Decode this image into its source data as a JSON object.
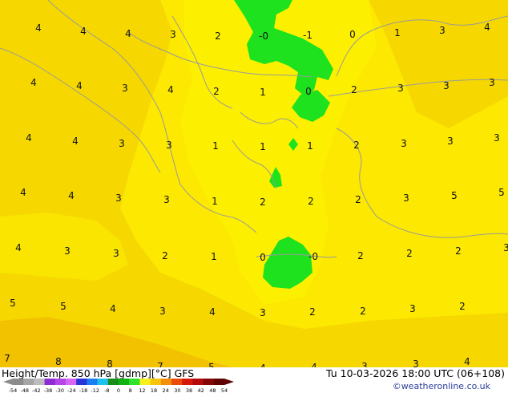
{
  "map": {
    "labels_grid": [
      [
        "4",
        "4",
        "4",
        "3",
        "2",
        "-0",
        "-1",
        "0",
        "1",
        "3",
        "4"
      ],
      [
        "4",
        "4",
        "3",
        "4",
        "2",
        "1",
        "0",
        "2",
        "3",
        "3",
        "3"
      ],
      [
        "4",
        "4",
        "3",
        "3",
        "1",
        "1",
        "1",
        "2",
        "3",
        "3",
        "3"
      ],
      [
        "4",
        "4",
        "3",
        "3",
        "1",
        "2",
        "2",
        "2",
        "3",
        "5",
        "5"
      ],
      [
        "4",
        "3",
        "3",
        "2",
        "1",
        "0",
        "-0",
        "2",
        "2",
        "2",
        "3"
      ],
      [
        "5",
        "5",
        "4",
        "3",
        "4",
        "3",
        "2",
        "2",
        "3",
        "2"
      ],
      [
        "7",
        "8",
        "8",
        "7",
        "5",
        "4",
        "4",
        "3",
        "3",
        "4"
      ]
    ],
    "colors": {
      "zone_yellow_dark": "#f6d800",
      "zone_yellow_light": "#fcf000",
      "zone_yellow_mid": "#f9e500",
      "zone_orange": "#f2c200",
      "zone_green": "#1ee21e",
      "coastline": "#9a9a9a"
    }
  },
  "footer": {
    "left_title": "Height/Temp. 850 hPa [gdmp][°C] GFS",
    "datetime": "Tu 10-03-2026 18:00 UTC (06+108)",
    "copyright": "©weatheronline.co.uk",
    "scale_ticks": [
      "-54",
      "-48",
      "-42",
      "-38",
      "-30",
      "-24",
      "-18",
      "-12",
      "-8",
      "0",
      "8",
      "12",
      "18",
      "24",
      "30",
      "38",
      "42",
      "48",
      "54"
    ],
    "scale_colors": [
      "#8c8c8c",
      "#a5a5a5",
      "#bdbdbd",
      "#8e2bd3",
      "#b445e8",
      "#d766f5",
      "#2a33d8",
      "#1b7ef0",
      "#1fc1ef",
      "#1a8c1a",
      "#10b410",
      "#2ee22e",
      "#f6f11a",
      "#f7c40c",
      "#f38f0a",
      "#ea4d0a",
      "#d61a0a",
      "#b40a0a",
      "#840606",
      "#5e0404"
    ]
  }
}
